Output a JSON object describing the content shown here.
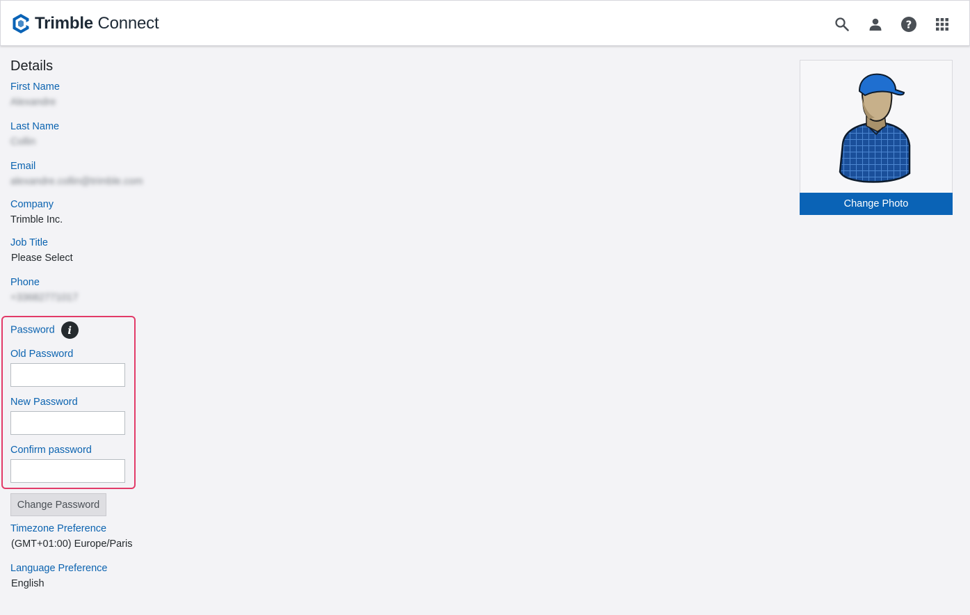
{
  "header": {
    "brand_bold": "Trimble",
    "brand_light": "Connect",
    "icons": [
      "search-icon",
      "user-icon",
      "help-icon",
      "apps-grid-icon"
    ]
  },
  "details": {
    "heading": "Details",
    "first_name_label": "First Name",
    "first_name_value": "Alexandre",
    "last_name_label": "Last Name",
    "last_name_value": "Collin",
    "email_label": "Email",
    "email_value": "alexandre.collin@trimble.com",
    "company_label": "Company",
    "company_value": "Trimble Inc.",
    "job_title_label": "Job Title",
    "job_title_value": "Please Select",
    "phone_label": "Phone",
    "phone_value": "+33682771017"
  },
  "password": {
    "section_label": "Password",
    "info_glyph": "i",
    "old_label": "Old Password",
    "old_value": "",
    "new_label": "New Password",
    "new_value": "",
    "confirm_label": "Confirm password",
    "confirm_value": "",
    "change_button": "Change Password"
  },
  "preferences": {
    "timezone_label": "Timezone Preference",
    "timezone_value": "(GMT+01:00) Europe/Paris",
    "language_label": "Language Preference",
    "language_value": "English"
  },
  "photo": {
    "change_button": "Change Photo"
  },
  "colors": {
    "accent": "#0a63b6",
    "label": "#0b63b0",
    "highlight": "#e23a68",
    "background": "#f3f3f6"
  }
}
